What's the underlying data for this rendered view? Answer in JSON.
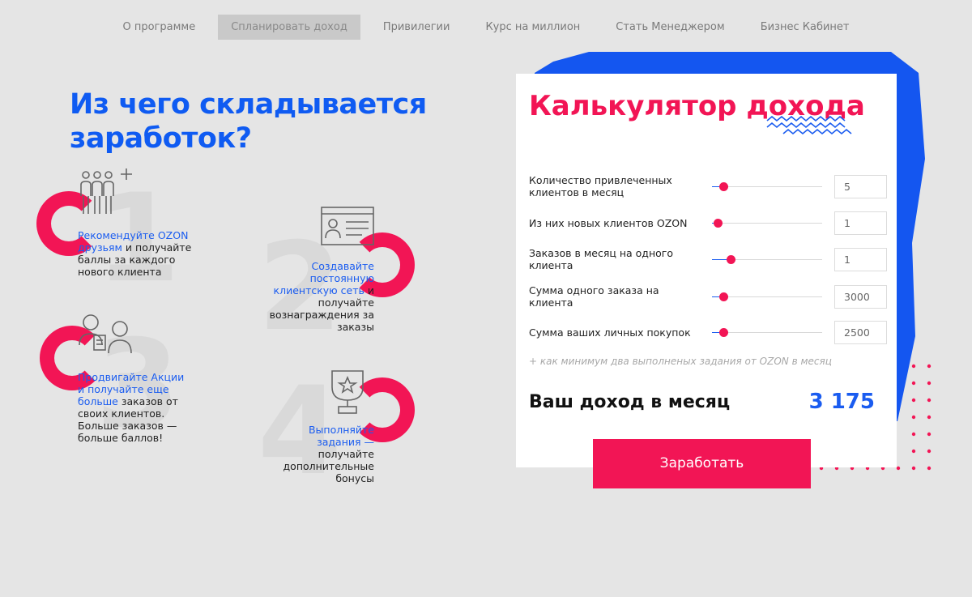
{
  "nav": {
    "items": [
      {
        "label": "О программе",
        "active": false
      },
      {
        "label": "Спланировать доход",
        "active": true
      },
      {
        "label": "Привилегии",
        "active": false
      },
      {
        "label": "Курс на миллион",
        "active": false
      },
      {
        "label": "Стать Менеджером",
        "active": false
      },
      {
        "label": "Бизнес Кабинет",
        "active": false
      }
    ]
  },
  "left": {
    "title": "Из чего складывается заработок?",
    "steps": [
      {
        "number": "1",
        "icon": "people-plus-icon",
        "highlight": "Рекомендуйте OZON друзьям",
        "rest": " и получайте баллы за каждого нового клиента"
      },
      {
        "number": "2",
        "icon": "profile-card-icon",
        "highlight": "Создавайте постоянную клиентскую сеть",
        "rest": " и получайте вознаграждения за заказы"
      },
      {
        "number": "3",
        "icon": "consult-people-icon",
        "highlight": "Продвигайте Акции и получайте еще больше",
        "rest": " заказов от своих клиентов. Больше заказов — больше баллов!"
      },
      {
        "number": "4",
        "icon": "trophy-icon",
        "highlight": "Выполняйте задания —",
        "rest": " получайте дополнительные бонусы"
      }
    ]
  },
  "calculator": {
    "title": "Калькулятор дохода",
    "rows": [
      {
        "label": "Количество привлеченных клиентов в месяц",
        "value": "5",
        "level": 0.05
      },
      {
        "label": "Из них новых клиентов OZON",
        "value": "1",
        "level": 0.0
      },
      {
        "label": "Заказов в месяц на одного клиента",
        "value": "1",
        "level": 0.12
      },
      {
        "label": "Сумма одного заказа на клиента",
        "value": "3000",
        "level": 0.05
      },
      {
        "label": "Сумма ваших личных покупок",
        "value": "2500",
        "level": 0.05
      }
    ],
    "note": "+ как минимум два выполненых задания от OZON в месяц",
    "income_label": "Ваш доход в месяц",
    "income_value": "3 175",
    "cta": "Заработать"
  },
  "colors": {
    "accent_red": "#f21555",
    "accent_blue": "#1a5cf0"
  }
}
